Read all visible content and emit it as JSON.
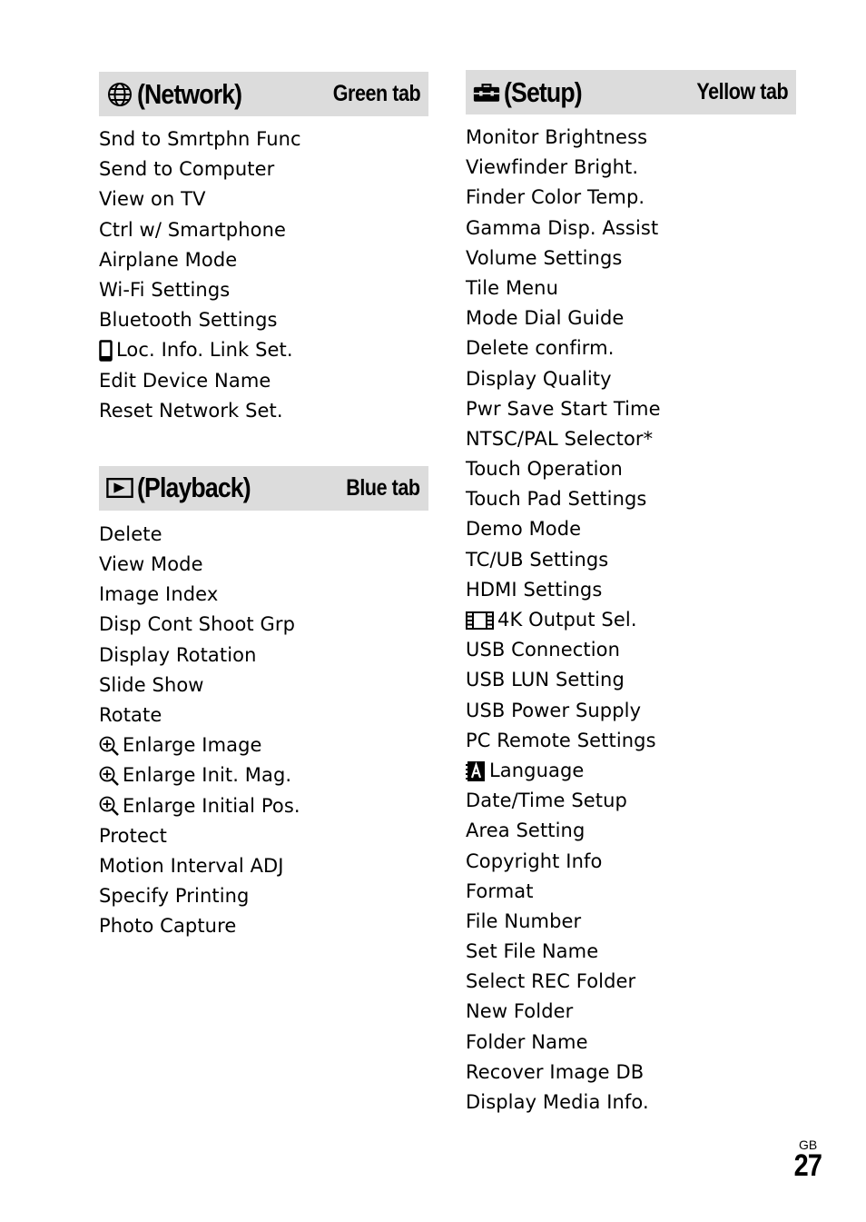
{
  "network": {
    "icon": "globe-icon",
    "title": "(Network)",
    "tab": "Green tab",
    "items": [
      {
        "label": "Snd to Smrtphn Func"
      },
      {
        "label": "Send to Computer"
      },
      {
        "label": "View on TV"
      },
      {
        "label": "Ctrl w/ Smartphone"
      },
      {
        "label": "Airplane Mode"
      },
      {
        "label": "Wi-Fi Settings"
      },
      {
        "label": "Bluetooth Settings"
      },
      {
        "label": "Loc. Info. Link Set.",
        "icon": "smartphone-icon"
      },
      {
        "label": "Edit Device Name"
      },
      {
        "label": "Reset Network Set."
      }
    ]
  },
  "playback": {
    "icon": "play-icon",
    "title": "(Playback)",
    "tab": "Blue tab",
    "items": [
      {
        "label": "Delete"
      },
      {
        "label": "View Mode"
      },
      {
        "label": "Image Index"
      },
      {
        "label": "Disp Cont Shoot Grp"
      },
      {
        "label": "Display Rotation"
      },
      {
        "label": "Slide Show"
      },
      {
        "label": "Rotate"
      },
      {
        "label": "Enlarge Image",
        "icon": "zoom-in-icon"
      },
      {
        "label": "Enlarge Init. Mag.",
        "icon": "zoom-in-icon"
      },
      {
        "label": "Enlarge Initial Pos.",
        "icon": "zoom-in-icon"
      },
      {
        "label": "Protect"
      },
      {
        "label": "Motion Interval ADJ"
      },
      {
        "label": "Specify Printing"
      },
      {
        "label": "Photo Capture"
      }
    ]
  },
  "setup": {
    "icon": "toolbox-icon",
    "title": "(Setup)",
    "tab": "Yellow tab",
    "items": [
      {
        "label": "Monitor Brightness"
      },
      {
        "label": "Viewfinder Bright."
      },
      {
        "label": "Finder Color Temp."
      },
      {
        "label": "Gamma Disp. Assist"
      },
      {
        "label": "Volume Settings"
      },
      {
        "label": "Tile Menu"
      },
      {
        "label": "Mode Dial Guide"
      },
      {
        "label": "Delete confirm."
      },
      {
        "label": "Display Quality"
      },
      {
        "label": "Pwr Save Start Time"
      },
      {
        "label": "NTSC/PAL Selector*"
      },
      {
        "label": "Touch Operation"
      },
      {
        "label": "Touch Pad Settings"
      },
      {
        "label": "Demo Mode"
      },
      {
        "label": "TC/UB Settings"
      },
      {
        "label": "HDMI Settings"
      },
      {
        "label": "4K Output Sel.",
        "icon": "movie-film-icon"
      },
      {
        "label": "USB Connection"
      },
      {
        "label": "USB LUN Setting"
      },
      {
        "label": "USB Power Supply"
      },
      {
        "label": "PC Remote Settings"
      },
      {
        "label": "Language",
        "icon": "language-icon"
      },
      {
        "label": "Date/Time Setup"
      },
      {
        "label": "Area Setting"
      },
      {
        "label": "Copyright Info"
      },
      {
        "label": "Format"
      },
      {
        "label": "File Number"
      },
      {
        "label": "Set File Name"
      },
      {
        "label": "Select REC Folder"
      },
      {
        "label": "New Folder"
      },
      {
        "label": "Folder Name"
      },
      {
        "label": "Recover Image DB"
      },
      {
        "label": "Display Media Info."
      }
    ]
  },
  "footer": {
    "region": "GB",
    "page_number": "27"
  }
}
